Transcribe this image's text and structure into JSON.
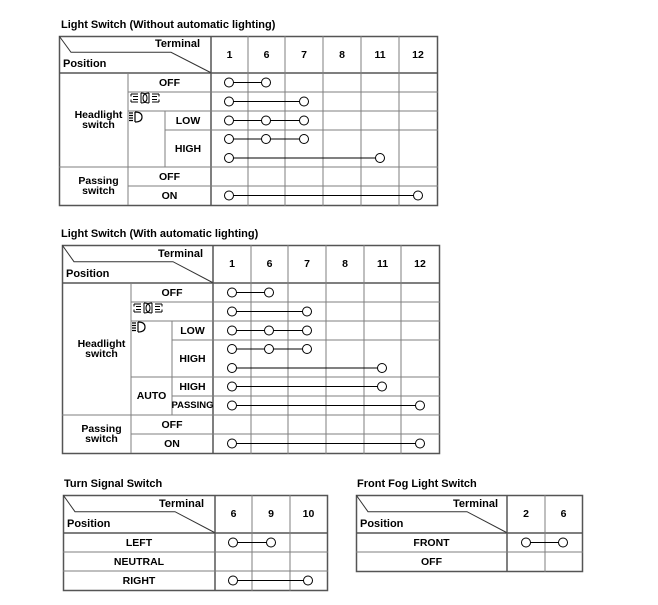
{
  "header_labels": {
    "terminal": "Terminal",
    "position": "Position"
  },
  "tables": [
    {
      "title": "Light Switch (Without automatic lighting)",
      "terminals": [
        "1",
        "6",
        "7",
        "8",
        "11",
        "12"
      ],
      "groups": {
        "headlight": "Headlight switch",
        "passing": "Passing switch",
        "headlight_icon": "headlight-high-beam-icon",
        "parking_icon": "parking-light-icon"
      },
      "rows": [
        {
          "group": "Headlight switch",
          "sub": "",
          "position": "OFF",
          "connections": [
            [
              "1",
              "6"
            ]
          ]
        },
        {
          "group": "Headlight switch",
          "sub": "",
          "position": "parking-light-icon",
          "connections": [
            [
              "1",
              "7"
            ]
          ]
        },
        {
          "group": "Headlight switch",
          "sub": "headlight-high-beam-icon",
          "position": "LOW",
          "connections": [
            [
              "1",
              "6",
              "7"
            ]
          ]
        },
        {
          "group": "Headlight switch",
          "sub": "headlight-high-beam-icon",
          "position": "HIGH",
          "connections": [
            [
              "1",
              "6",
              "7"
            ],
            [
              "1",
              "11"
            ]
          ]
        },
        {
          "group": "Passing switch",
          "sub": "",
          "position": "OFF",
          "connections": []
        },
        {
          "group": "Passing switch",
          "sub": "",
          "position": "ON",
          "connections": [
            [
              "1",
              "12"
            ]
          ]
        }
      ]
    },
    {
      "title": "Light Switch (With automatic lighting)",
      "terminals": [
        "1",
        "6",
        "7",
        "8",
        "11",
        "12"
      ],
      "groups": {
        "headlight": "Headlight switch",
        "passing": "Passing switch",
        "auto": "AUTO",
        "headlight_icon": "headlight-high-beam-icon",
        "parking_icon": "parking-light-icon"
      },
      "rows": [
        {
          "group": "Headlight switch",
          "sub": "",
          "position": "OFF",
          "connections": [
            [
              "1",
              "6"
            ]
          ]
        },
        {
          "group": "Headlight switch",
          "sub": "",
          "position": "parking-light-icon",
          "connections": [
            [
              "1",
              "7"
            ]
          ]
        },
        {
          "group": "Headlight switch",
          "sub": "headlight-high-beam-icon",
          "position": "LOW",
          "connections": [
            [
              "1",
              "6",
              "7"
            ]
          ]
        },
        {
          "group": "Headlight switch",
          "sub": "headlight-high-beam-icon",
          "position": "HIGH",
          "connections": [
            [
              "1",
              "6",
              "7"
            ],
            [
              "1",
              "11"
            ]
          ]
        },
        {
          "group": "Headlight switch",
          "sub": "AUTO",
          "position": "HIGH",
          "connections": [
            [
              "1",
              "11"
            ]
          ]
        },
        {
          "group": "Headlight switch",
          "sub": "AUTO",
          "position": "PASSING",
          "connections": [
            [
              "1",
              "12"
            ]
          ]
        },
        {
          "group": "Passing switch",
          "sub": "",
          "position": "OFF",
          "connections": []
        },
        {
          "group": "Passing switch",
          "sub": "",
          "position": "ON",
          "connections": [
            [
              "1",
              "12"
            ]
          ]
        }
      ]
    },
    {
      "title": "Turn Signal Switch",
      "terminals": [
        "6",
        "9",
        "10"
      ],
      "rows": [
        {
          "position": "LEFT",
          "connections": [
            [
              "6",
              "9"
            ]
          ]
        },
        {
          "position": "NEUTRAL",
          "connections": []
        },
        {
          "position": "RIGHT",
          "connections": [
            [
              "6",
              "10"
            ]
          ]
        }
      ]
    },
    {
      "title": "Front Fog Light Switch",
      "terminals": [
        "2",
        "6"
      ],
      "rows": [
        {
          "position": "FRONT",
          "connections": [
            [
              "2",
              "6"
            ]
          ]
        },
        {
          "position": "OFF",
          "connections": []
        }
      ]
    }
  ],
  "colors": {
    "grid": "#7f7f7f",
    "border": "#555555",
    "line": "#000000"
  }
}
